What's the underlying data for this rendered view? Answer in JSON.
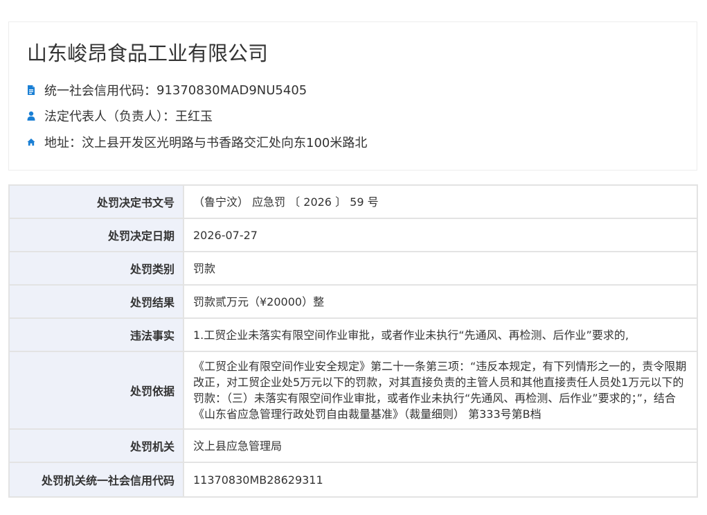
{
  "company": {
    "name": "山东峻昂食品工业有限公司",
    "credit_code_label": "统一社会信用代码：",
    "credit_code": "91370830MAD9NU5405",
    "legal_rep_label": "法定代表人（负责人）：",
    "legal_rep": "王红玉",
    "address_label": "地址：",
    "address": "汶上县开发区光明路与书香路交汇处向东100米路北",
    "icons": [
      "document-icon",
      "user-icon",
      "home-icon"
    ],
    "icon_color": "#1a7fd4"
  },
  "penalty": {
    "rows": [
      {
        "label": "处罚决定书文号",
        "value": "（鲁宁汶） 应急罚 〔 2026 〕 59 号"
      },
      {
        "label": "处罚决定日期",
        "value": "2026-07-27"
      },
      {
        "label": "处罚类别",
        "value": "罚款"
      },
      {
        "label": "处罚结果",
        "value": "罚款贰万元（¥20000）整"
      },
      {
        "label": "违法事实",
        "value": "1.工贸企业未落实有限空间作业审批，或者作业未执行“先通风、再检测、后作业”要求的,"
      },
      {
        "label": "处罚依据",
        "value": "《工贸企业有限空间作业安全规定》第二十一条第三项：“违反本规定，有下列情形之一的，责令限期改正，对工贸企业处5万元以下的罚款，对其直接负责的主管人员和其他直接责任人员处1万元以下的罚款：（三）未落实有限空间作业审批，或者作业未执行“先通风、再检测、后作业”要求的；”，结合《山东省应急管理行政处罚自由裁量基准》（裁量细则） 第333号第B档"
      },
      {
        "label": "处罚机关",
        "value": "汶上县应急管理局"
      },
      {
        "label": "处罚机关统一社会信用代码",
        "value": "11370830MB28629311"
      }
    ],
    "label_bg": "#eef1f9",
    "border_color": "#e3e3e3"
  }
}
